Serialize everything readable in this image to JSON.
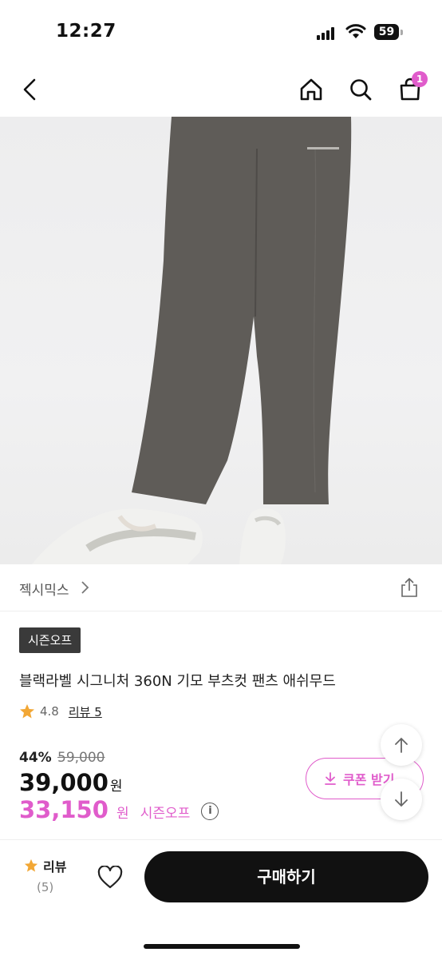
{
  "status_bar": {
    "time": "12:27",
    "battery": "59"
  },
  "nav": {
    "cart_count": "1"
  },
  "brand": {
    "name": "젝시믹스"
  },
  "product": {
    "badge": "시즌오프",
    "title": "블랙라벨 시그니처 360N 기모 부츠컷 팬츠 애쉬무드",
    "rating": "4.8",
    "review_label": "리뷰 5",
    "discount_rate": "44%",
    "original_price": "59,000",
    "price": "39,000",
    "price_unit": "원",
    "sale_price": "33,150",
    "sale_unit": "원",
    "sale_label": "시즌오프",
    "coupon_label": "쿠폰 받기"
  },
  "bottom_bar": {
    "review_label": "리뷰",
    "review_count": "(5)",
    "buy_label": "구매하기"
  },
  "colors": {
    "accent": "#e05ccb",
    "dark": "#111111",
    "star": "#f2a735",
    "pants": "#5f5c58"
  }
}
